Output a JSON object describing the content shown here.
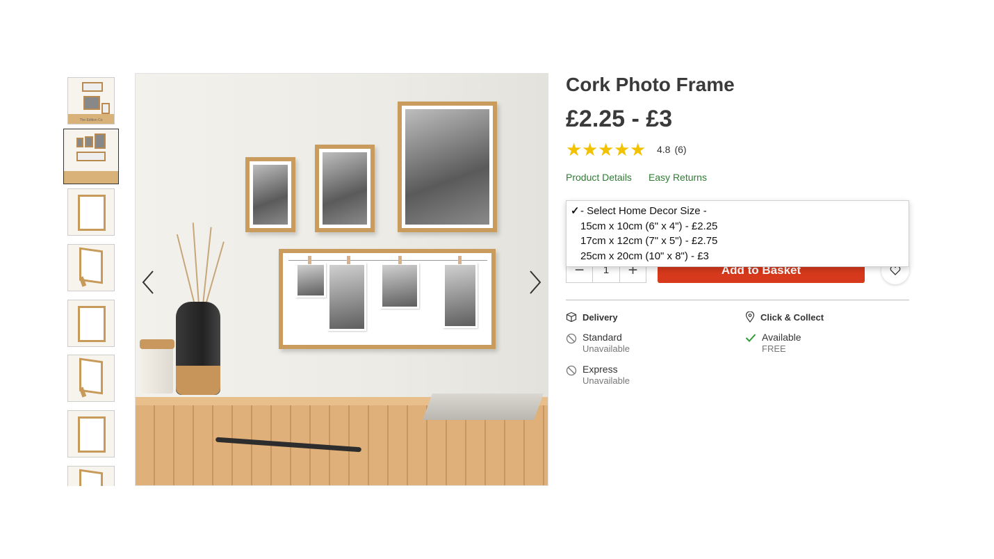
{
  "product": {
    "title": "Cork Photo Frame",
    "price": "£2.25 - £3",
    "rating": {
      "stars": 5,
      "value": "4.8",
      "count": "(6)"
    },
    "links": [
      "Product Details",
      "Easy Returns"
    ]
  },
  "size_select": {
    "options": [
      {
        "label": "- Select Home Decor Size -",
        "selected": true
      },
      {
        "label": "15cm x 10cm (6\" x 4\") - £2.25",
        "selected": false
      },
      {
        "label": "17cm x 12cm (7\" x 5\") - £2.75",
        "selected": false
      },
      {
        "label": "25cm x 20cm (10\" x 8\") - £3",
        "selected": false
      }
    ]
  },
  "purchase": {
    "quantity": "1",
    "minus": "−",
    "plus": "+",
    "add_label": "Add to Basket"
  },
  "fulfilment": {
    "delivery": {
      "heading": "Delivery",
      "options": [
        {
          "label": "Standard",
          "status": "Unavailable",
          "icon": "unavailable-icon"
        },
        {
          "label": "Express",
          "status": "Unavailable",
          "icon": "unavailable-icon"
        }
      ]
    },
    "collect": {
      "heading": "Click & Collect",
      "options": [
        {
          "label": "Available",
          "status": "FREE",
          "icon": "check-icon"
        }
      ]
    }
  },
  "gallery": {
    "thumb_count": 8,
    "selected_index": 1,
    "thumb_caption": "The Edition Co"
  },
  "colors": {
    "accent_green": "#2e7d32",
    "cta_red": "#d7391c",
    "star_yellow": "#f2c200",
    "check_green": "#2e9d3a"
  }
}
